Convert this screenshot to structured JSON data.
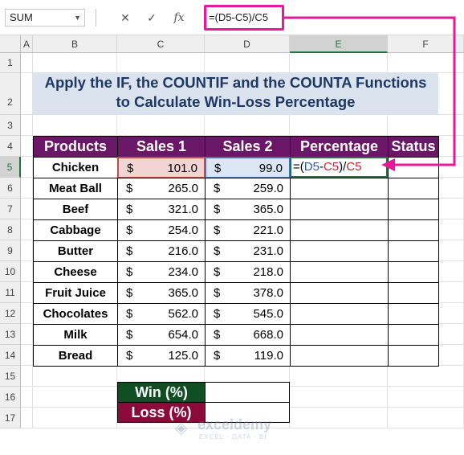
{
  "formula_bar": {
    "name_box": "SUM",
    "cancel_icon": "✕",
    "enter_icon": "✓",
    "fx_icon": "fx",
    "formula": "=(D5-C5)/C5"
  },
  "columns": [
    "A",
    "B",
    "C",
    "D",
    "E",
    "F"
  ],
  "rows": [
    "1",
    "2",
    "3",
    "4",
    "5",
    "6",
    "7",
    "8",
    "9",
    "10",
    "11",
    "12",
    "13",
    "14",
    "15",
    "16",
    "17"
  ],
  "title": {
    "line1": "Apply the IF, the COUNTIF and the COUNTA Functions",
    "line2": "to Calculate Win-Loss Percentage"
  },
  "table": {
    "headers": [
      "Products",
      "Sales 1",
      "Sales 2",
      "Percentage",
      "Status"
    ],
    "currency": "$",
    "rows": [
      {
        "product": "Chicken",
        "s1": "101.0",
        "s2": "99.0"
      },
      {
        "product": "Meat Ball",
        "s1": "265.0",
        "s2": "259.0"
      },
      {
        "product": "Beef",
        "s1": "321.0",
        "s2": "365.0"
      },
      {
        "product": "Cabbage",
        "s1": "254.0",
        "s2": "221.0"
      },
      {
        "product": "Butter",
        "s1": "216.0",
        "s2": "231.0"
      },
      {
        "product": "Cheese",
        "s1": "234.0",
        "s2": "218.0"
      },
      {
        "product": "Fruit Juice",
        "s1": "365.0",
        "s2": "378.0"
      },
      {
        "product": "Chocolates",
        "s1": "562.0",
        "s2": "545.0"
      },
      {
        "product": "Milk",
        "s1": "654.0",
        "s2": "668.0"
      },
      {
        "product": "Bread",
        "s1": "125.0",
        "s2": "119.0"
      }
    ]
  },
  "editing_cell": {
    "eq": "=(",
    "ref1": "D5",
    "minus": "-",
    "ref2": "C5",
    "rest": ")/",
    "ref3": "C5"
  },
  "summary": {
    "win_label": "Win (%)",
    "loss_label": "Loss (%)"
  },
  "watermark": {
    "brand": "exceldemy",
    "tagline": "EXCEL · DATA · BI"
  },
  "colors": {
    "header_purple": "#6b1768",
    "win_green": "#0f4d23",
    "loss_red": "#8b0a3a",
    "highlight_pink": "#e8189a"
  }
}
